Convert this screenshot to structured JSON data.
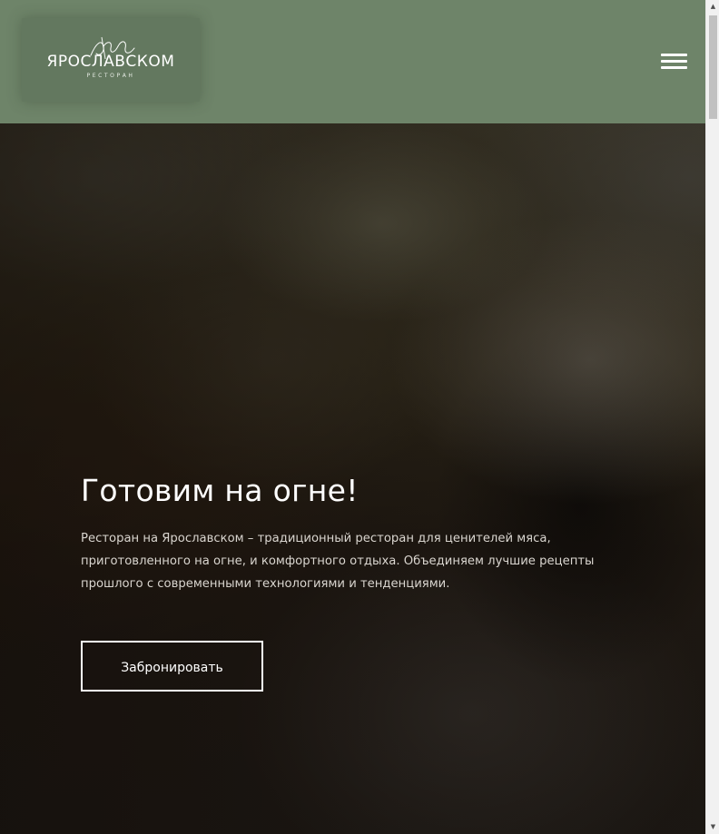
{
  "header": {
    "logo": {
      "script_text": "на",
      "name": "ЯРОСЛАВСКОМ",
      "subtitle": "РЕСТОРАН"
    },
    "menu_icon": "hamburger-icon"
  },
  "hero": {
    "title": "Готовим на огне!",
    "description": "Ресторан на Ярославском – традиционный ресторан для ценителей мяса, приготовленного на огне, и комфортного отдыха. Объединяем лучшие рецепты прошлого с современными технологиями и тенденциями.",
    "button_label": "Забронировать"
  },
  "scrollbar": {
    "up_icon": "triangle-up-icon",
    "down_icon": "triangle-down-icon"
  },
  "colors": {
    "header_bg": "#6e8469",
    "text_primary": "#ffffff",
    "text_secondary": "#d9d5cf",
    "hero_bg": "#1e1a16"
  }
}
